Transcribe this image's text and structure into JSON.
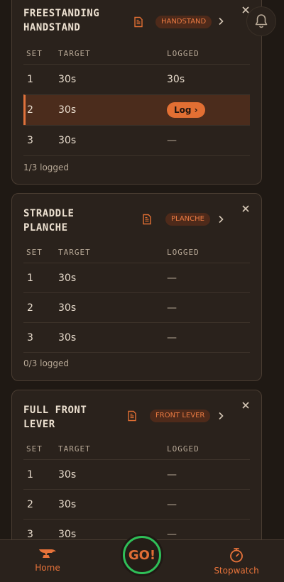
{
  "cards": [
    {
      "title_line1": "FREESTANDING",
      "title_line2": "HANDSTAND",
      "tag": "HANDSTAND",
      "columns": [
        "SET",
        "TARGET",
        "LOGGED"
      ],
      "rows": [
        {
          "set": "1",
          "target": "30s",
          "logged": "30s"
        },
        {
          "set": "2",
          "target": "30s",
          "logged": "Log ›",
          "active": true
        },
        {
          "set": "3",
          "target": "30s",
          "logged": "—"
        }
      ],
      "summary": "1/3 logged"
    },
    {
      "title_line1": "STRADDLE",
      "title_line2": "PLANCHE",
      "tag": "PLANCHE",
      "columns": [
        "SET",
        "TARGET",
        "LOGGED"
      ],
      "rows": [
        {
          "set": "1",
          "target": "30s",
          "logged": "—"
        },
        {
          "set": "2",
          "target": "30s",
          "logged": "—"
        },
        {
          "set": "3",
          "target": "30s",
          "logged": "—"
        }
      ],
      "summary": "0/3 logged"
    },
    {
      "title_line1": "FULL FRONT",
      "title_line2": "LEVER",
      "tag": "FRONT LEVER",
      "columns": [
        "SET",
        "TARGET",
        "LOGGED"
      ],
      "rows": [
        {
          "set": "1",
          "target": "30s",
          "logged": "—"
        },
        {
          "set": "2",
          "target": "30s",
          "logged": "—"
        },
        {
          "set": "3",
          "target": "30s",
          "logged": "—"
        }
      ]
    }
  ],
  "nav": {
    "home_label": "Home",
    "go_label": "GO!",
    "stopwatch_label": "Stopwatch"
  },
  "icons": {
    "note": "note-icon",
    "chevron": "chevron-right-icon",
    "close": "close-icon",
    "bell": "bell-icon",
    "home": "anvil-icon",
    "stopwatch": "stopwatch-icon"
  },
  "colors": {
    "accent": "#e26f33",
    "go_ring": "#2fbf58",
    "background": "#1f1914",
    "card": "#2a221c"
  }
}
